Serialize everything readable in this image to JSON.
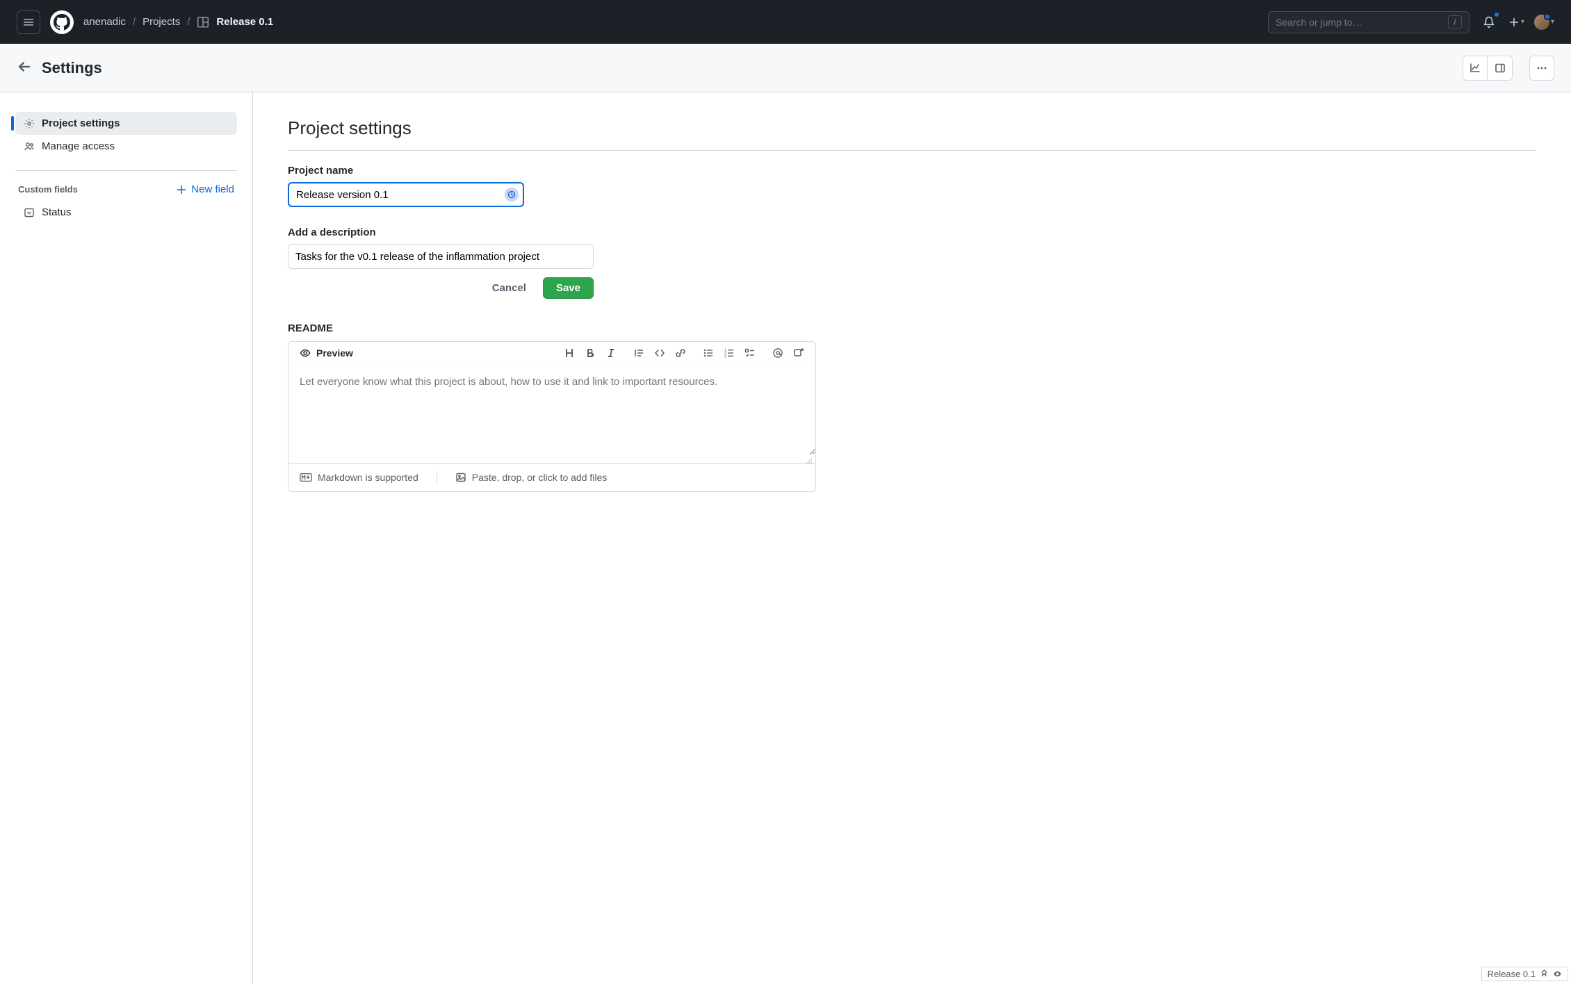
{
  "header": {
    "owner": "anenadic",
    "projects_label": "Projects",
    "project_name": "Release 0.1",
    "search_placeholder": "Search or jump to…",
    "search_key": "/"
  },
  "subheader": {
    "title": "Settings"
  },
  "sidebar": {
    "project_settings": "Project settings",
    "manage_access": "Manage access",
    "custom_fields_label": "Custom fields",
    "new_field_label": "New field",
    "status_field": "Status"
  },
  "main": {
    "heading": "Project settings",
    "name_label": "Project name",
    "name_value": "Release version 0.1",
    "desc_label": "Add a description",
    "desc_value": "Tasks for the v0.1 release of the inflammation project",
    "cancel_label": "Cancel",
    "save_label": "Save",
    "readme_label": "README",
    "preview_tab": "Preview",
    "readme_placeholder": "Let everyone know what this project is about, how to use it and link to important resources.",
    "markdown_supported": "Markdown is supported",
    "upload_hint": "Paste, drop, or click to add files"
  },
  "float": {
    "label": "Release 0.1"
  }
}
